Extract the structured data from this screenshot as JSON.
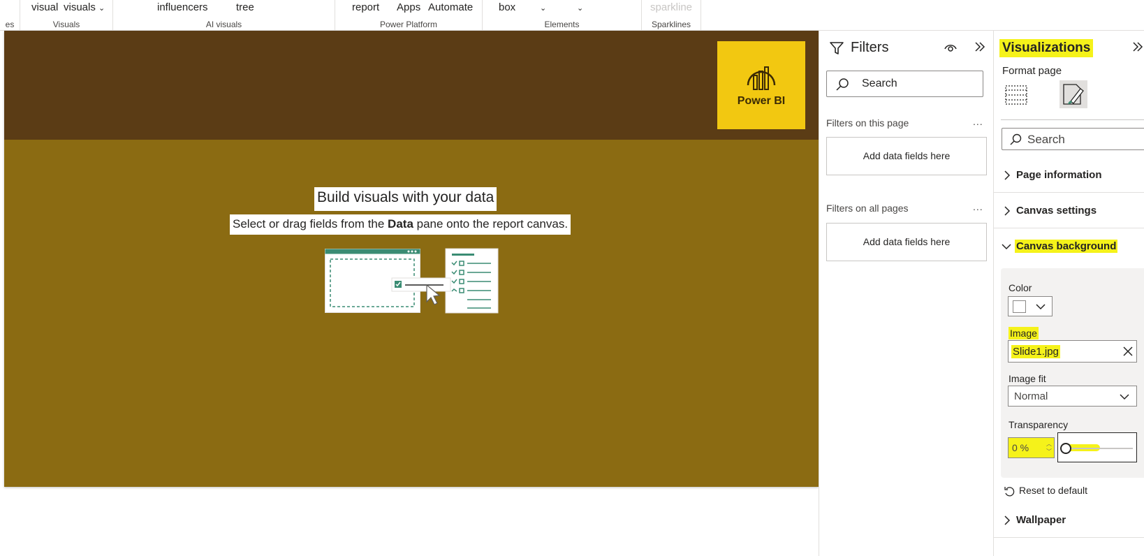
{
  "ribbon": {
    "groups": [
      {
        "label": "es",
        "items": []
      },
      {
        "label": "Visuals",
        "items": [
          "visual",
          "visuals"
        ]
      },
      {
        "label": "AI visuals",
        "items": [
          "influencers",
          "tree"
        ]
      },
      {
        "label": "Power Platform",
        "items": [
          "report",
          "Apps",
          "Automate"
        ]
      },
      {
        "label": "Elements",
        "items": [
          "box"
        ]
      },
      {
        "label": "Sparklines",
        "items": [
          "sparkline"
        ]
      }
    ]
  },
  "canvas": {
    "logo_text": "Power BI",
    "build_title": "Build visuals with your data",
    "build_sub_before": "Select or drag fields from the ",
    "build_sub_bold": "Data",
    "build_sub_after": " pane onto the report canvas.",
    "colors": {
      "header": "#5b3c15",
      "body": "#8b6b12",
      "logo": "#f2c811"
    }
  },
  "filters": {
    "title": "Filters",
    "search_placeholder": "Search",
    "section_page": "Filters on this page",
    "section_all": "Filters on all pages",
    "more": "...",
    "drop_page": "Add data fields here",
    "drop_all": "Add data fields here"
  },
  "viz": {
    "title": "Visualizations",
    "format_page": "Format page",
    "search_placeholder": "Search",
    "sections": {
      "page_information": "Page information",
      "canvas_settings": "Canvas settings",
      "canvas_background": "Canvas background",
      "wallpaper": "Wallpaper"
    },
    "canvas_background": {
      "color_label": "Color",
      "image_label": "Image",
      "image_value": "Slide1.jpg",
      "image_fit_label": "Image fit",
      "image_fit_value": "Normal",
      "transparency_label": "Transparency",
      "transparency_value": "0 %",
      "transparency_level": 0,
      "reset_label": "Reset to default"
    },
    "highlight_color": "#f5f21a"
  }
}
